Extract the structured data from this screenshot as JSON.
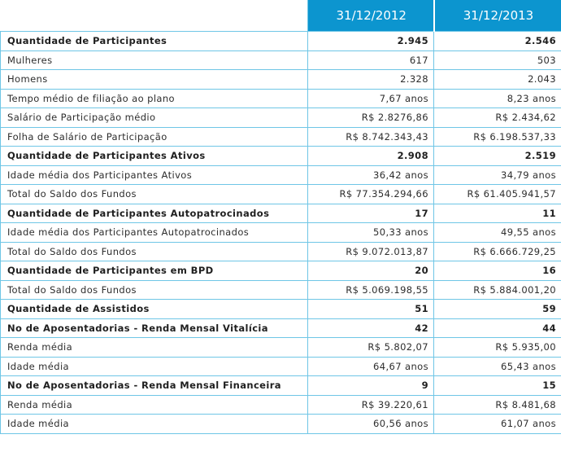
{
  "header": {
    "year1": "31/12/2012",
    "year2": "31/12/2013"
  },
  "rows": [
    {
      "label": "Quantidade de Participantes",
      "y1": "2.945",
      "y2": "2.546",
      "bold": true
    },
    {
      "label": "Mulheres",
      "y1": "617",
      "y2": "503",
      "bold": false
    },
    {
      "label": "Homens",
      "y1": "2.328",
      "y2": "2.043",
      "bold": false
    },
    {
      "label": "Tempo médio de filiação ao plano",
      "y1": "7,67 anos",
      "y2": "8,23 anos",
      "bold": false
    },
    {
      "label": "Salário de Participação médio",
      "y1": "R$ 2.8276,86",
      "y2": "R$ 2.434,62",
      "bold": false
    },
    {
      "label": "Folha de Salário de Participação",
      "y1": "R$ 8.742.343,43",
      "y2": "R$ 6.198.537,33",
      "bold": false
    },
    {
      "label": "Quantidade de Participantes Ativos",
      "y1": "2.908",
      "y2": "2.519",
      "bold": true
    },
    {
      "label": "Idade média dos Participantes Ativos",
      "y1": "36,42 anos",
      "y2": "34,79 anos",
      "bold": false
    },
    {
      "label": "Total do Saldo dos Fundos",
      "y1": "R$ 77.354.294,66",
      "y2": "R$ 61.405.941,57",
      "bold": false
    },
    {
      "label": "Quantidade de Participantes Autopatrocinados",
      "y1": "17",
      "y2": "11",
      "bold": true
    },
    {
      "label": "Idade média dos Participantes Autopatrocinados",
      "y1": "50,33 anos",
      "y2": "49,55 anos",
      "bold": false
    },
    {
      "label": "Total do Saldo dos Fundos",
      "y1": "R$ 9.072.013,87",
      "y2": "R$ 6.666.729,25",
      "bold": false
    },
    {
      "label": "Quantidade de Participantes em BPD",
      "y1": "20",
      "y2": "16",
      "bold": true
    },
    {
      "label": "Total do Saldo dos Fundos",
      "y1": "R$ 5.069.198,55",
      "y2": "R$ 5.884.001,20",
      "bold": false
    },
    {
      "label": "Quantidade de Assistidos",
      "y1": "51",
      "y2": "59",
      "bold": true
    },
    {
      "label": "No de Aposentadorias - Renda Mensal Vitalícia",
      "y1": "42",
      "y2": "44",
      "bold": true
    },
    {
      "label": "Renda média",
      "y1": "R$ 5.802,07",
      "y2": "R$ 5.935,00",
      "bold": false
    },
    {
      "label": "Idade média",
      "y1": "64,67 anos",
      "y2": "65,43 anos",
      "bold": false
    },
    {
      "label": "No de Aposentadorias - Renda Mensal Financeira",
      "y1": "9",
      "y2": "15",
      "bold": true
    },
    {
      "label": "Renda média",
      "y1": "R$ 39.220,61",
      "y2": "R$ 8.481,68",
      "bold": false
    },
    {
      "label": "Idade média",
      "y1": "60,56 anos",
      "y2": "61,07 anos",
      "bold": false
    }
  ],
  "colors": {
    "header_bg": "#0c95cf",
    "grid": "#6fc6e6",
    "text": "#2d2d2d"
  }
}
